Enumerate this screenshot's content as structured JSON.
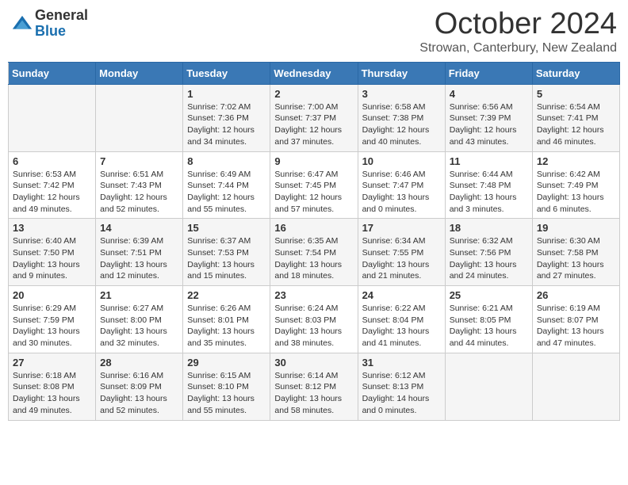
{
  "header": {
    "logo_general": "General",
    "logo_blue": "Blue",
    "month_title": "October 2024",
    "location": "Strowan, Canterbury, New Zealand"
  },
  "days_of_week": [
    "Sunday",
    "Monday",
    "Tuesday",
    "Wednesday",
    "Thursday",
    "Friday",
    "Saturday"
  ],
  "weeks": [
    [
      {
        "day": "",
        "info": ""
      },
      {
        "day": "",
        "info": ""
      },
      {
        "day": "1",
        "info": "Sunrise: 7:02 AM\nSunset: 7:36 PM\nDaylight: 12 hours\nand 34 minutes."
      },
      {
        "day": "2",
        "info": "Sunrise: 7:00 AM\nSunset: 7:37 PM\nDaylight: 12 hours\nand 37 minutes."
      },
      {
        "day": "3",
        "info": "Sunrise: 6:58 AM\nSunset: 7:38 PM\nDaylight: 12 hours\nand 40 minutes."
      },
      {
        "day": "4",
        "info": "Sunrise: 6:56 AM\nSunset: 7:39 PM\nDaylight: 12 hours\nand 43 minutes."
      },
      {
        "day": "5",
        "info": "Sunrise: 6:54 AM\nSunset: 7:41 PM\nDaylight: 12 hours\nand 46 minutes."
      }
    ],
    [
      {
        "day": "6",
        "info": "Sunrise: 6:53 AM\nSunset: 7:42 PM\nDaylight: 12 hours\nand 49 minutes."
      },
      {
        "day": "7",
        "info": "Sunrise: 6:51 AM\nSunset: 7:43 PM\nDaylight: 12 hours\nand 52 minutes."
      },
      {
        "day": "8",
        "info": "Sunrise: 6:49 AM\nSunset: 7:44 PM\nDaylight: 12 hours\nand 55 minutes."
      },
      {
        "day": "9",
        "info": "Sunrise: 6:47 AM\nSunset: 7:45 PM\nDaylight: 12 hours\nand 57 minutes."
      },
      {
        "day": "10",
        "info": "Sunrise: 6:46 AM\nSunset: 7:47 PM\nDaylight: 13 hours\nand 0 minutes."
      },
      {
        "day": "11",
        "info": "Sunrise: 6:44 AM\nSunset: 7:48 PM\nDaylight: 13 hours\nand 3 minutes."
      },
      {
        "day": "12",
        "info": "Sunrise: 6:42 AM\nSunset: 7:49 PM\nDaylight: 13 hours\nand 6 minutes."
      }
    ],
    [
      {
        "day": "13",
        "info": "Sunrise: 6:40 AM\nSunset: 7:50 PM\nDaylight: 13 hours\nand 9 minutes."
      },
      {
        "day": "14",
        "info": "Sunrise: 6:39 AM\nSunset: 7:51 PM\nDaylight: 13 hours\nand 12 minutes."
      },
      {
        "day": "15",
        "info": "Sunrise: 6:37 AM\nSunset: 7:53 PM\nDaylight: 13 hours\nand 15 minutes."
      },
      {
        "day": "16",
        "info": "Sunrise: 6:35 AM\nSunset: 7:54 PM\nDaylight: 13 hours\nand 18 minutes."
      },
      {
        "day": "17",
        "info": "Sunrise: 6:34 AM\nSunset: 7:55 PM\nDaylight: 13 hours\nand 21 minutes."
      },
      {
        "day": "18",
        "info": "Sunrise: 6:32 AM\nSunset: 7:56 PM\nDaylight: 13 hours\nand 24 minutes."
      },
      {
        "day": "19",
        "info": "Sunrise: 6:30 AM\nSunset: 7:58 PM\nDaylight: 13 hours\nand 27 minutes."
      }
    ],
    [
      {
        "day": "20",
        "info": "Sunrise: 6:29 AM\nSunset: 7:59 PM\nDaylight: 13 hours\nand 30 minutes."
      },
      {
        "day": "21",
        "info": "Sunrise: 6:27 AM\nSunset: 8:00 PM\nDaylight: 13 hours\nand 32 minutes."
      },
      {
        "day": "22",
        "info": "Sunrise: 6:26 AM\nSunset: 8:01 PM\nDaylight: 13 hours\nand 35 minutes."
      },
      {
        "day": "23",
        "info": "Sunrise: 6:24 AM\nSunset: 8:03 PM\nDaylight: 13 hours\nand 38 minutes."
      },
      {
        "day": "24",
        "info": "Sunrise: 6:22 AM\nSunset: 8:04 PM\nDaylight: 13 hours\nand 41 minutes."
      },
      {
        "day": "25",
        "info": "Sunrise: 6:21 AM\nSunset: 8:05 PM\nDaylight: 13 hours\nand 44 minutes."
      },
      {
        "day": "26",
        "info": "Sunrise: 6:19 AM\nSunset: 8:07 PM\nDaylight: 13 hours\nand 47 minutes."
      }
    ],
    [
      {
        "day": "27",
        "info": "Sunrise: 6:18 AM\nSunset: 8:08 PM\nDaylight: 13 hours\nand 49 minutes."
      },
      {
        "day": "28",
        "info": "Sunrise: 6:16 AM\nSunset: 8:09 PM\nDaylight: 13 hours\nand 52 minutes."
      },
      {
        "day": "29",
        "info": "Sunrise: 6:15 AM\nSunset: 8:10 PM\nDaylight: 13 hours\nand 55 minutes."
      },
      {
        "day": "30",
        "info": "Sunrise: 6:14 AM\nSunset: 8:12 PM\nDaylight: 13 hours\nand 58 minutes."
      },
      {
        "day": "31",
        "info": "Sunrise: 6:12 AM\nSunset: 8:13 PM\nDaylight: 14 hours\nand 0 minutes."
      },
      {
        "day": "",
        "info": ""
      },
      {
        "day": "",
        "info": ""
      }
    ]
  ]
}
